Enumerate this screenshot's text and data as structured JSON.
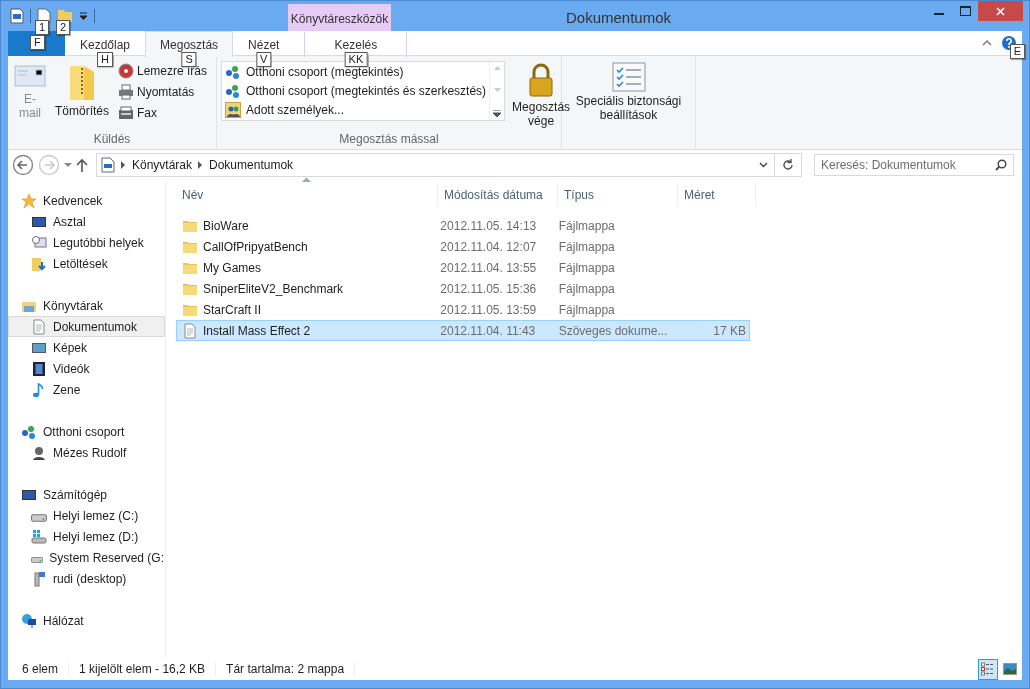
{
  "quick_access": {
    "key_tips": [
      "1",
      "2"
    ]
  },
  "context_tab_group": {
    "label": "Könyvtáreszközök"
  },
  "window": {
    "title": "Dokumentumok"
  },
  "file_tab": {
    "key_tip": "F"
  },
  "ribbon_tabs": [
    {
      "label": "Kezdőlap",
      "key_tip": "H",
      "selected": false,
      "contextual": false
    },
    {
      "label": "Megosztás",
      "key_tip": "S",
      "selected": true,
      "contextual": false
    },
    {
      "label": "Nézet",
      "key_tip": "V",
      "selected": false,
      "contextual": false
    },
    {
      "label": "Kezelés",
      "key_tip": "KK",
      "selected": false,
      "contextual": true
    }
  ],
  "help": {
    "key_tip": "E"
  },
  "ribbon_groups": [
    {
      "label": "Küldés",
      "commands": [
        {
          "kind": "large",
          "label": "E-mail",
          "disabled": true
        },
        {
          "kind": "large",
          "label": "Tömörítés",
          "disabled": false
        },
        {
          "kind": "small_stack",
          "items": [
            "Lemezre írás",
            "Nyomtatás",
            "Fax"
          ]
        }
      ]
    },
    {
      "label": "Megosztás mással",
      "commands": [
        {
          "kind": "gallery",
          "items": [
            "Otthoni csoport (megtekintés)",
            "Otthoni csoport (megtekintés és szerkesztés)",
            "Adott személyek..."
          ]
        },
        {
          "kind": "large",
          "label": "Megosztás vége",
          "disabled": false
        }
      ]
    },
    {
      "commands": [
        {
          "kind": "large",
          "label": "Speciális biztonsági beállítások",
          "disabled": false
        }
      ]
    }
  ],
  "address_bar": {
    "breadcrumbs": [
      "Könyvtárak",
      "Dokumentumok"
    ]
  },
  "search": {
    "placeholder": "Keresés: Dokumentumok"
  },
  "navigation": {
    "groups": [
      {
        "label": "Kedvencek",
        "children": [
          {
            "label": "Asztal",
            "selected": false
          },
          {
            "label": "Legutóbbi helyek",
            "selected": false
          },
          {
            "label": "Letöltések",
            "selected": false
          }
        ]
      },
      {
        "label": "Könyvtárak",
        "children": [
          {
            "label": "Dokumentumok",
            "selected": true
          },
          {
            "label": "Képek",
            "selected": false
          },
          {
            "label": "Videók",
            "selected": false
          },
          {
            "label": "Zene",
            "selected": false
          }
        ]
      },
      {
        "label": "Otthoni csoport",
        "children": [
          {
            "label": "Mézes Rudolf",
            "selected": false
          }
        ]
      },
      {
        "label": "Számítógép",
        "children": [
          {
            "label": "Helyi lemez (C:)",
            "selected": false
          },
          {
            "label": "Helyi lemez (D:)",
            "selected": false
          },
          {
            "label": "System Reserved (G:",
            "selected": false
          },
          {
            "label": "rudi (desktop)",
            "selected": false
          }
        ]
      },
      {
        "label": "Hálózat"
      }
    ]
  },
  "file_list": {
    "columns": [
      {
        "label": "Név",
        "sorted": true
      },
      {
        "label": "Módosítás dátuma",
        "sorted": false
      },
      {
        "label": "Típus",
        "sorted": false
      },
      {
        "label": "Méret",
        "sorted": false
      }
    ],
    "rows": [
      {
        "kind": "folder",
        "name": "BioWare",
        "date": "2012.11.05. 14:13",
        "type": "Fájlmappa",
        "selected": false
      },
      {
        "kind": "folder",
        "name": "CallOfPripyatBench",
        "date": "2012.11.04. 12:07",
        "type": "Fájlmappa",
        "selected": false
      },
      {
        "kind": "folder",
        "name": "My Games",
        "date": "2012.11.04. 13:55",
        "type": "Fájlmappa",
        "selected": false
      },
      {
        "kind": "folder",
        "name": "SniperEliteV2_Benchmark",
        "date": "2012.11.05. 15:36",
        "type": "Fájlmappa",
        "selected": false
      },
      {
        "kind": "folder",
        "name": "StarCraft II",
        "date": "2012.11.05. 13:59",
        "type": "Fájlmappa",
        "selected": false
      },
      {
        "kind": "document",
        "name": "Install Mass Effect 2",
        "date": "2012.11.04. 11:43",
        "type": "Szöveges dokume...",
        "size": "17 KB",
        "selected": true
      }
    ]
  },
  "status_bar": {
    "items": [
      "6 elem",
      "1 kijelölt elem - 16,2 KB",
      "Tár tartalma: 2 mappa"
    ],
    "views": [
      {
        "selected": true
      },
      {
        "selected": false
      }
    ]
  }
}
